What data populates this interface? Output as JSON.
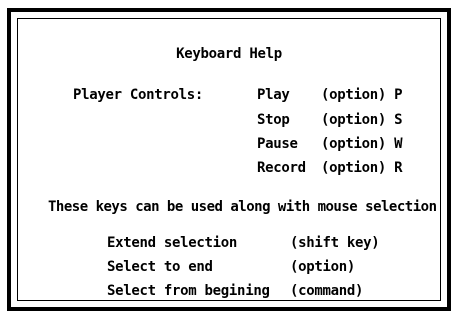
{
  "dialog": {
    "title": "Keyboard Help",
    "player_controls_label": "Player Controls:",
    "player_controls": [
      {
        "name": "Play",
        "key": "(option) P"
      },
      {
        "name": "Stop",
        "key": "(option) S"
      },
      {
        "name": "Pause",
        "key": "(option) W"
      },
      {
        "name": "Record",
        "key": "(option) R"
      }
    ],
    "mouse_note": "These keys can be used along with mouse selection",
    "selection_controls": [
      {
        "name": "Extend selection",
        "key": "(shift key)"
      },
      {
        "name": "Select to end",
        "key": "(option)"
      },
      {
        "name": "Select from begining",
        "key": "(command)"
      }
    ]
  }
}
